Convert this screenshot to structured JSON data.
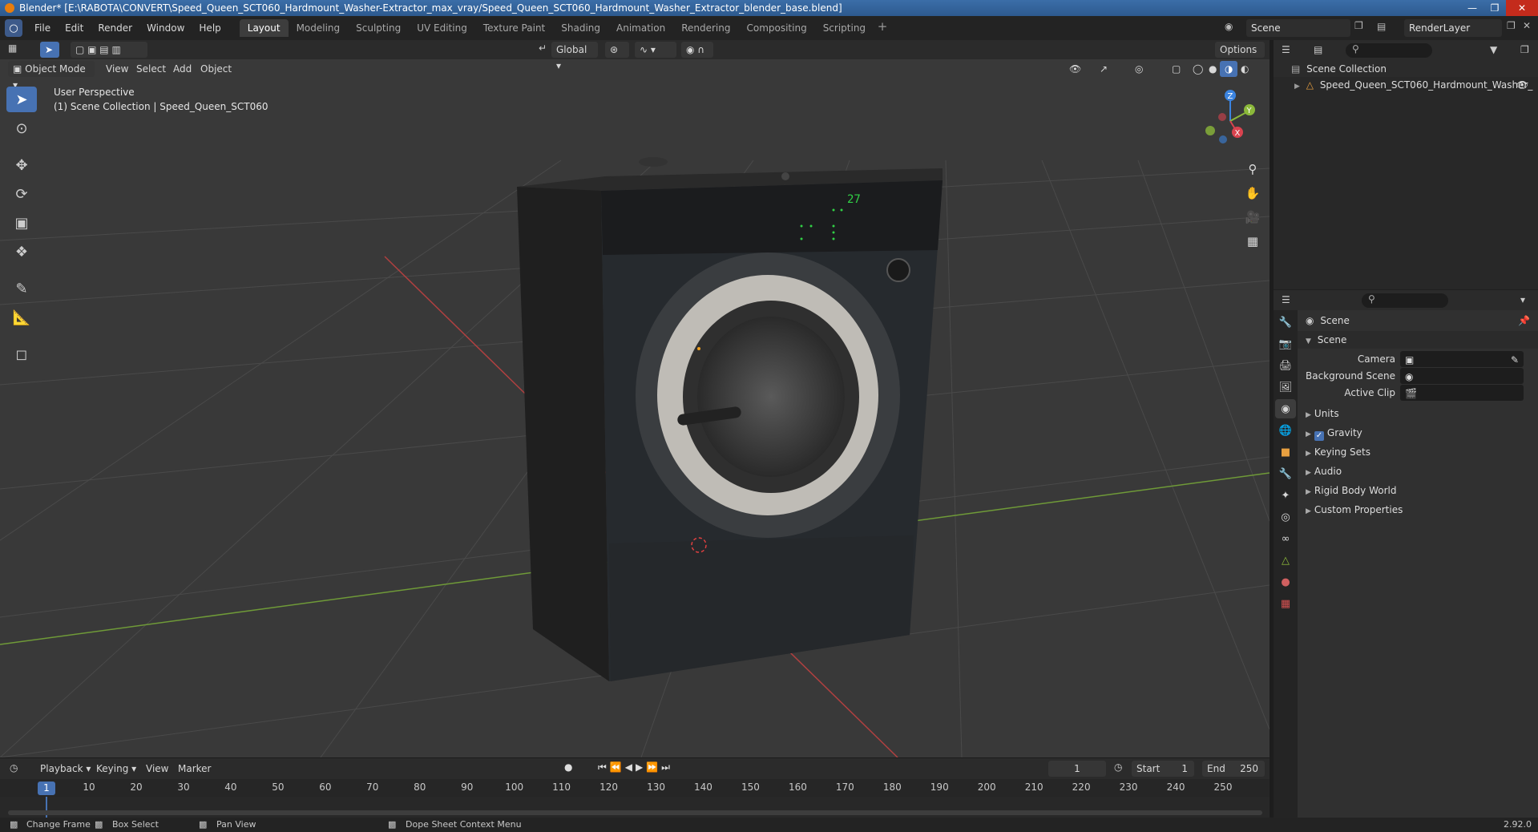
{
  "window": {
    "title": "Blender* [E:\\RABOTA\\CONVERT\\Speed_Queen_SCT060_Hardmount_Washer-Extractor_max_vray/Speed_Queen_SCT060_Hardmount_Washer_Extractor_blender_base.blend]"
  },
  "menu": [
    "File",
    "Edit",
    "Render",
    "Window",
    "Help"
  ],
  "workspaces": [
    "Layout",
    "Modeling",
    "Sculpting",
    "UV Editing",
    "Texture Paint",
    "Shading",
    "Animation",
    "Rendering",
    "Compositing",
    "Scripting"
  ],
  "active_workspace": "Layout",
  "scene_selector": "Scene",
  "view_layer_selector": "RenderLayer",
  "viewport_header": {
    "mode": "Object Mode",
    "menus": [
      "View",
      "Select",
      "Add",
      "Object"
    ],
    "transform_orientation": "Global",
    "options_label": "Options"
  },
  "viewport": {
    "perspective_label": "User Perspective",
    "collection_label": "(1) Scene Collection | Speed_Queen_SCT060",
    "display_readout": "27",
    "gizmo_axes": {
      "x": "X",
      "y": "Y",
      "z": "Z"
    },
    "colors": {
      "x_axis": "#d9434f",
      "y_axis": "#8bb83a",
      "z_axis": "#3b84e0",
      "selection": "#4772b3"
    }
  },
  "outliner": {
    "root": "Scene Collection",
    "items": [
      {
        "label": "Speed_Queen_SCT060_Hardmount_Washer_"
      }
    ]
  },
  "properties": {
    "context_label": "Scene",
    "panel_title": "Scene",
    "fields": [
      {
        "label": "Camera",
        "value": ""
      },
      {
        "label": "Background Scene",
        "value": ""
      },
      {
        "label": "Active Clip",
        "value": ""
      }
    ],
    "sections": [
      {
        "label": "Units",
        "checkbox": false
      },
      {
        "label": "Gravity",
        "checkbox": true
      },
      {
        "label": "Keying Sets",
        "checkbox": false
      },
      {
        "label": "Audio",
        "checkbox": false
      },
      {
        "label": "Rigid Body World",
        "checkbox": false
      },
      {
        "label": "Custom Properties",
        "checkbox": false
      }
    ]
  },
  "timeline": {
    "menus": [
      "Playback",
      "Keying",
      "View",
      "Marker"
    ],
    "current_frame": "1",
    "start_label": "Start",
    "start": "1",
    "end_label": "End",
    "end": "250",
    "ticks": [
      "1",
      "10",
      "20",
      "30",
      "40",
      "50",
      "60",
      "70",
      "80",
      "90",
      "100",
      "110",
      "120",
      "130",
      "140",
      "150",
      "160",
      "170",
      "180",
      "190",
      "200",
      "210",
      "220",
      "230",
      "240",
      "250"
    ]
  },
  "statusbar": {
    "items": [
      "Change Frame",
      "Box Select",
      "Pan View",
      "Dope Sheet Context Menu"
    ],
    "version": "2.92.0"
  }
}
